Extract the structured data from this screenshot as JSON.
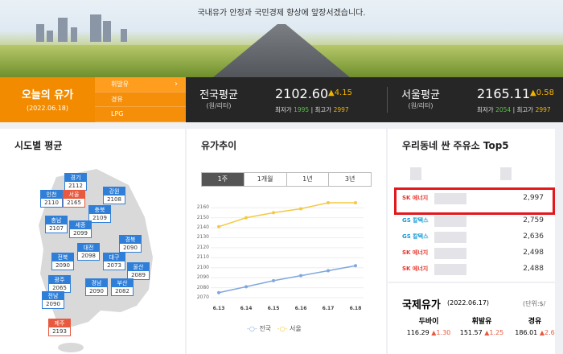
{
  "hero": {
    "slogan": "국내유가 안정과 국민경제 향상에 앞장서겠습니다."
  },
  "today": {
    "title": "오늘의 유가",
    "date": "(2022.06.18)"
  },
  "fuel_menu": [
    {
      "label": "휘발유",
      "active": true
    },
    {
      "label": "경유",
      "active": false
    },
    {
      "label": "LPG",
      "active": false
    }
  ],
  "national": {
    "label": "전국평균",
    "unit": "(원/리터)",
    "value": "2102.60",
    "change": "▲4.15",
    "min_label": "최저가",
    "min": "1995",
    "max_label": "최고가",
    "max": "2997"
  },
  "seoul": {
    "label": "서울평균",
    "unit": "(원/리터)",
    "value": "2165.11",
    "change": "▲0.58",
    "min_label": "최저가",
    "min": "2054",
    "max_label": "최고가",
    "max": "2997"
  },
  "regional": {
    "title": "시도별 평균",
    "regions": [
      {
        "name": "경기",
        "value": "2112",
        "red": false
      },
      {
        "name": "인천",
        "value": "2110",
        "red": false
      },
      {
        "name": "서울",
        "value": "2165",
        "red": true
      },
      {
        "name": "강원",
        "value": "2108",
        "red": false
      },
      {
        "name": "충북",
        "value": "2109",
        "red": false
      },
      {
        "name": "충남",
        "value": "2107",
        "red": false
      },
      {
        "name": "세종",
        "value": "2099",
        "red": false
      },
      {
        "name": "경북",
        "value": "2090",
        "red": false
      },
      {
        "name": "대전",
        "value": "2098",
        "red": false
      },
      {
        "name": "전북",
        "value": "2090",
        "red": false
      },
      {
        "name": "대구",
        "value": "2073",
        "red": false
      },
      {
        "name": "울산",
        "value": "2089",
        "red": false
      },
      {
        "name": "광주",
        "value": "2065",
        "red": false
      },
      {
        "name": "경남",
        "value": "2090",
        "red": false
      },
      {
        "name": "부산",
        "value": "2082",
        "red": false
      },
      {
        "name": "전남",
        "value": "2090",
        "red": false
      },
      {
        "name": "제주",
        "value": "2193",
        "red": true
      }
    ]
  },
  "trend": {
    "title": "유가추이",
    "tabs": [
      "1주",
      "1개월",
      "1년",
      "3년"
    ],
    "active_tab": "1주"
  },
  "chart_data": {
    "type": "line",
    "x": [
      "6.13",
      "6.14",
      "6.15",
      "6.16",
      "6.17",
      "6.18"
    ],
    "series": [
      {
        "name": "전국",
        "color": "#7fa8df",
        "values": [
          2075,
          2081,
          2087,
          2092,
          2097,
          2102
        ]
      },
      {
        "name": "서울",
        "color": "#f5c842",
        "values": [
          2141,
          2150,
          2155,
          2159,
          2165,
          2165
        ]
      }
    ],
    "yticks": [
      "2070",
      "2080",
      "2090",
      "2100",
      "2110",
      "2120",
      "2130",
      "2140",
      "2150",
      "2160"
    ],
    "ylim": [
      2070,
      2165
    ]
  },
  "top5": {
    "title": "우리동네 싼 주유소 Top5",
    "stations": [
      {
        "brand": "SK 에너지",
        "price": "2,997"
      },
      {
        "brand": "GS 칼텍스",
        "price": "2,759"
      },
      {
        "brand": "GS 칼텍스",
        "price": "2,636"
      },
      {
        "brand": "SK 에너지",
        "price": "2,498"
      },
      {
        "brand": "SK 에너지",
        "price": "2,488"
      }
    ]
  },
  "international": {
    "title": "국제유가",
    "date": "(2022.06.17)",
    "unit": "(단위:$/",
    "items": [
      {
        "name": "두바이",
        "value": "116.29",
        "change": "▲1.30"
      },
      {
        "name": "휘발유",
        "value": "151.57",
        "change": "▲1.25"
      },
      {
        "name": "경유",
        "value": "186.01",
        "change": "▲2.6"
      }
    ]
  }
}
